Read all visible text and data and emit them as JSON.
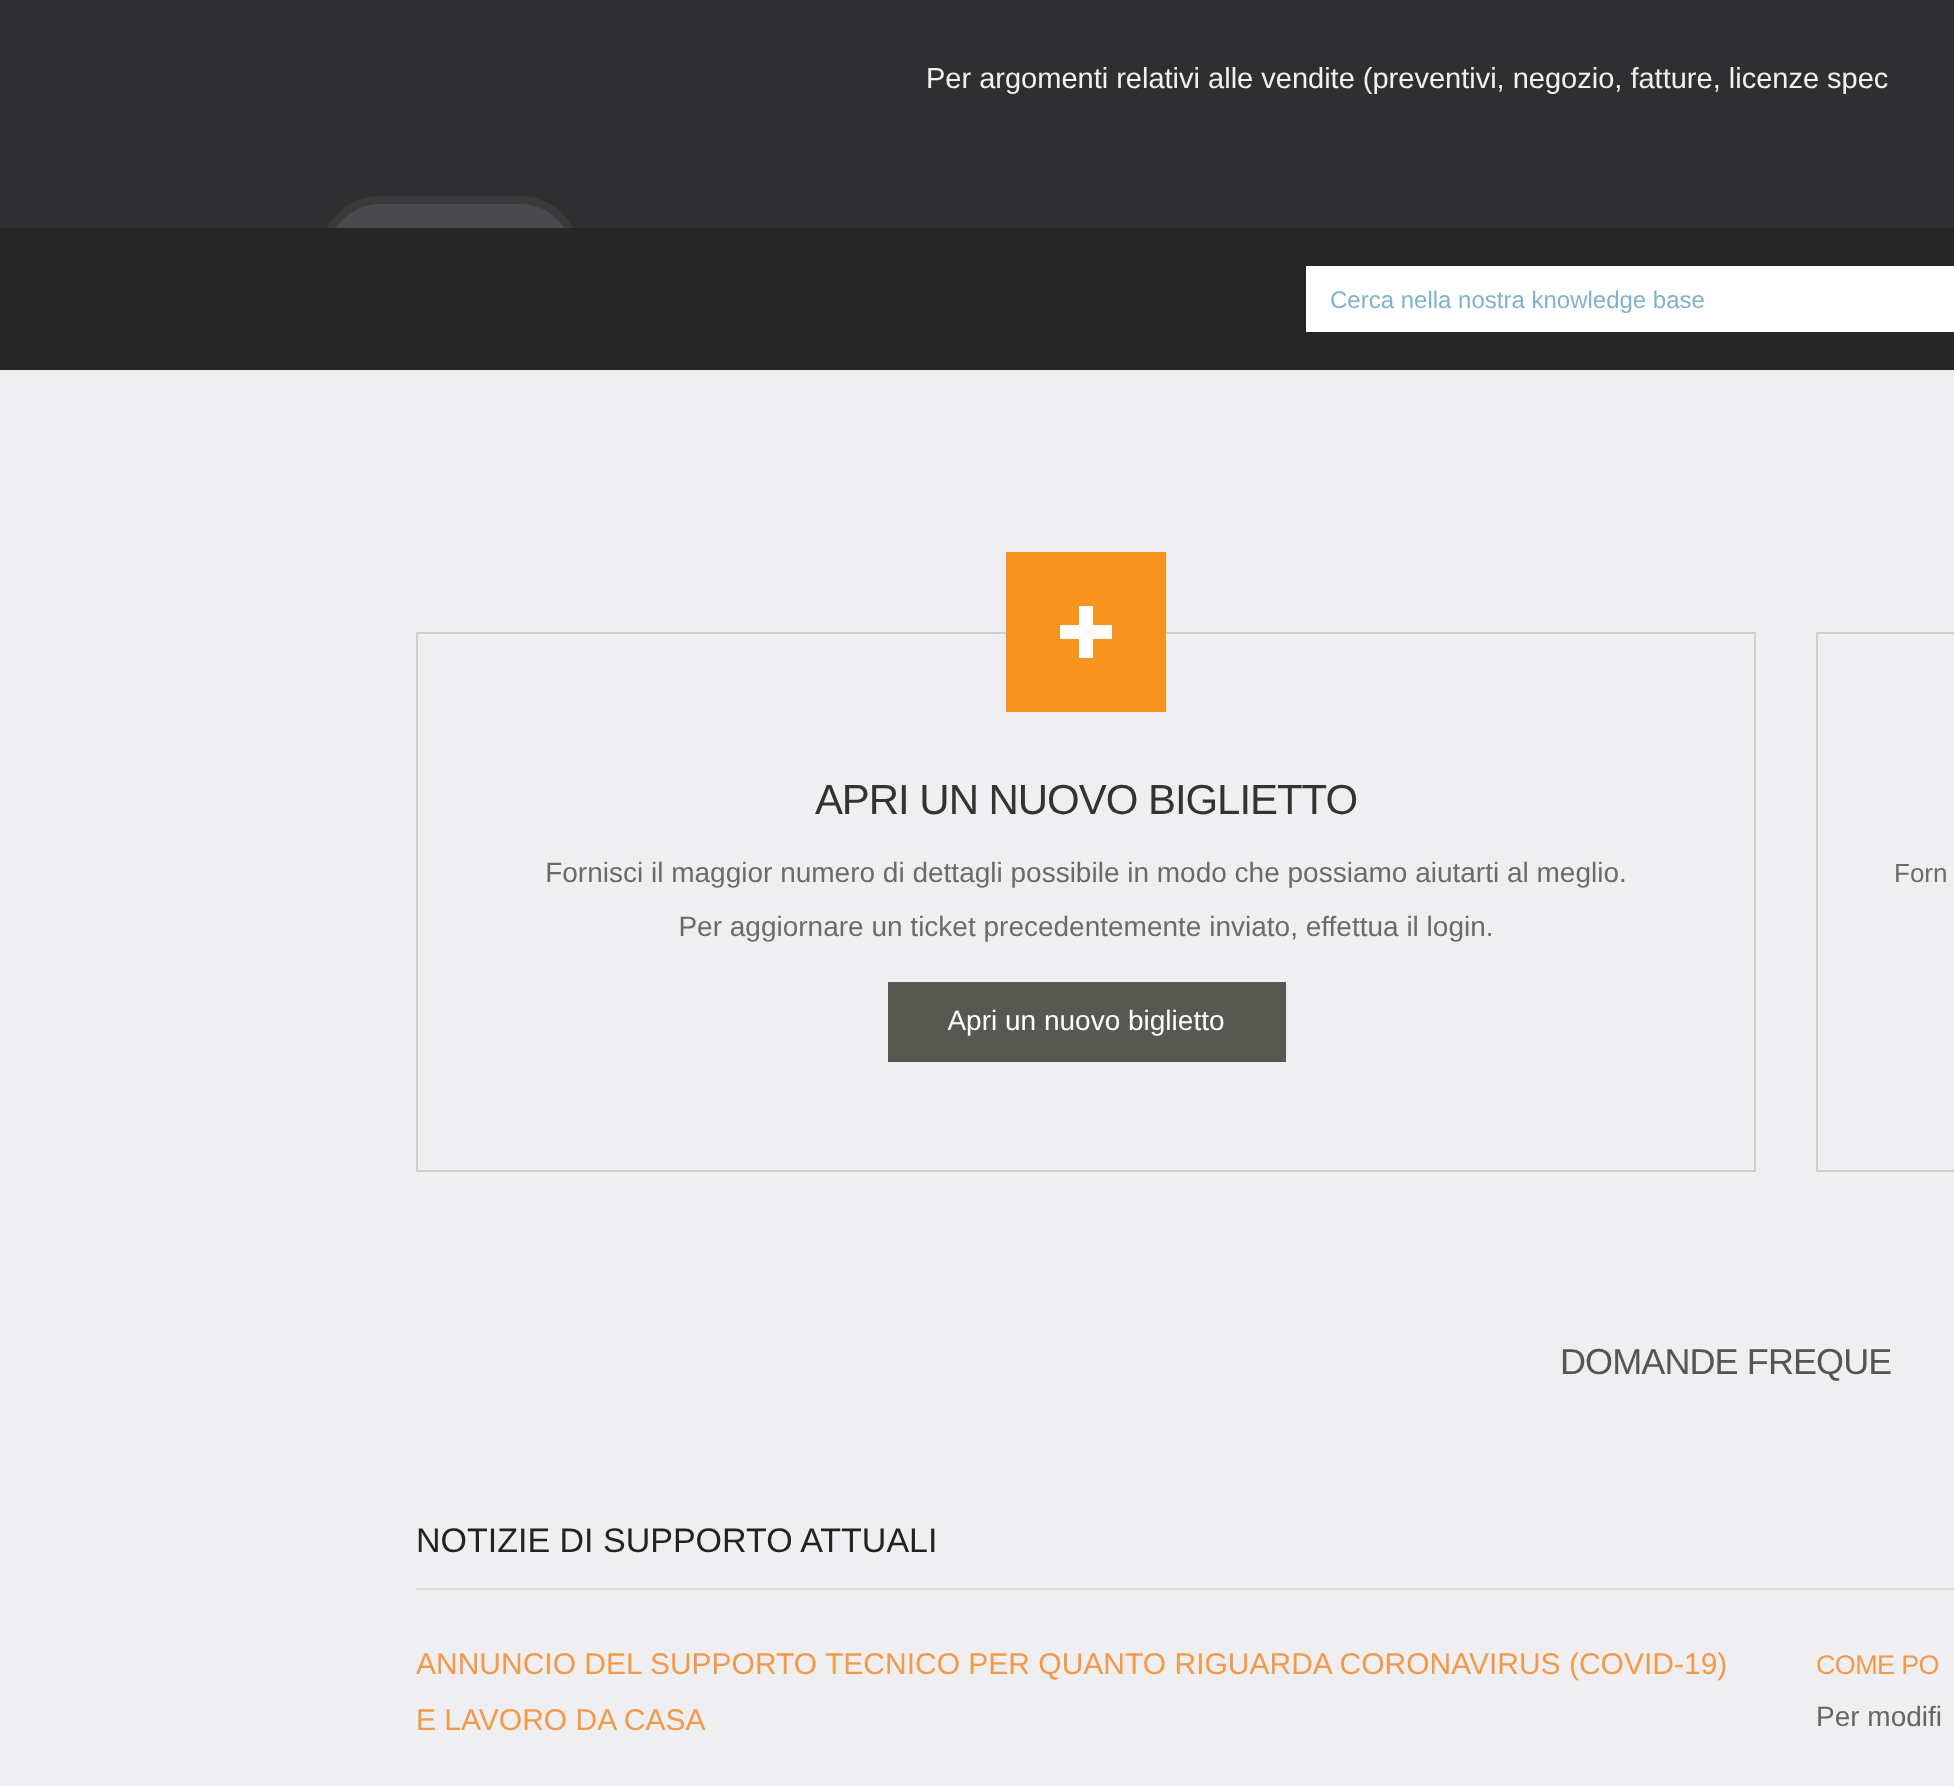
{
  "hero": {
    "text": "Per argomenti relativi alle vendite (preventivi, negozio, fatture, licenze spec"
  },
  "search": {
    "placeholder": "Cerca nella nostra knowledge base"
  },
  "cards": [
    {
      "kind": "new_ticket",
      "title": "APRI UN NUOVO BIGLIETTO",
      "lines": [
        "Fornisci il maggior numero di dettagli possibile in modo che possiamo aiutarti al meglio.",
        "Per aggiornare un ticket precedentemente inviato, effettua il login."
      ],
      "button": "Apri un nuovo biglietto"
    },
    {
      "kind": "partial",
      "lines": [
        "Forn"
      ]
    }
  ],
  "faq_heading": "DOMANDE FREQUE",
  "news": {
    "heading": "NOTIZIE DI SUPPORTO ATTUALI",
    "articles": [
      {
        "title": "ANNUNCIO DEL SUPPORTO TECNICO PER QUANTO RIGUARDA CORONAVIRUS (COVID-19) E LAVORO DA CASA"
      },
      {
        "title": "COME PO",
        "summary": "Per modifi"
      }
    ]
  }
}
